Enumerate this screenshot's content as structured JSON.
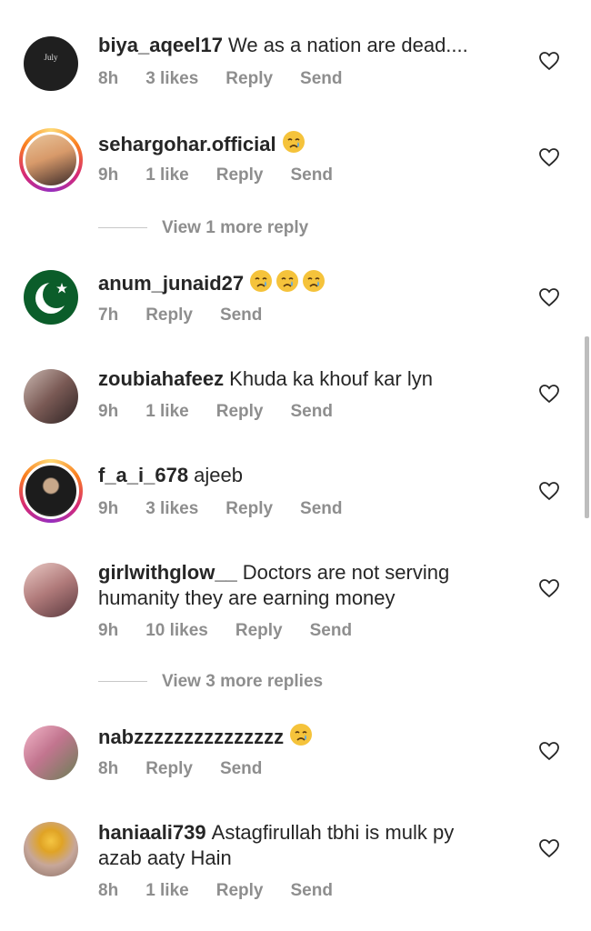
{
  "comments": [
    {
      "user": "biya_aqeel17",
      "text": "We as a nation are dead....",
      "time": "8h",
      "likes": "3 likes",
      "reply": "Reply",
      "send": "Send",
      "avatar_text": "July"
    },
    {
      "user": "sehargohar.official",
      "text": "",
      "time": "9h",
      "likes": "1 like",
      "reply": "Reply",
      "send": "Send"
    },
    {
      "user": "anum_junaid27",
      "text": "",
      "time": "7h",
      "likes": "",
      "reply": "Reply",
      "send": "Send"
    },
    {
      "user": "zoubiahafeez",
      "text": "Khuda ka khouf kar lyn",
      "time": "9h",
      "likes": "1 like",
      "reply": "Reply",
      "send": "Send"
    },
    {
      "user": "f_a_i_678",
      "text": "ajeeb",
      "time": "9h",
      "likes": "3 likes",
      "reply": "Reply",
      "send": "Send"
    },
    {
      "user": "girlwithglow__",
      "text": "Doctors are not serving humanity they are earning money",
      "time": "9h",
      "likes": "10 likes",
      "reply": "Reply",
      "send": "Send"
    },
    {
      "user": "nabzzzzzzzzzzzzzzz",
      "text": "",
      "time": "8h",
      "likes": "",
      "reply": "Reply",
      "send": "Send"
    },
    {
      "user": "haniaali739",
      "text": "Astagfirullah tbhi is mulk py azab aaty Hain",
      "time": "8h",
      "likes": "1 like",
      "reply": "Reply",
      "send": "Send"
    }
  ],
  "view_more": [
    {
      "label": "View 1 more reply"
    },
    {
      "label": "View 3 more replies"
    }
  ],
  "colors": {
    "text": "#262626",
    "muted": "#8e8e8e",
    "emoji": "#f5c33b"
  },
  "icons": {
    "heart": "heart-icon",
    "crying_emoji": "crying-face-emoji"
  }
}
